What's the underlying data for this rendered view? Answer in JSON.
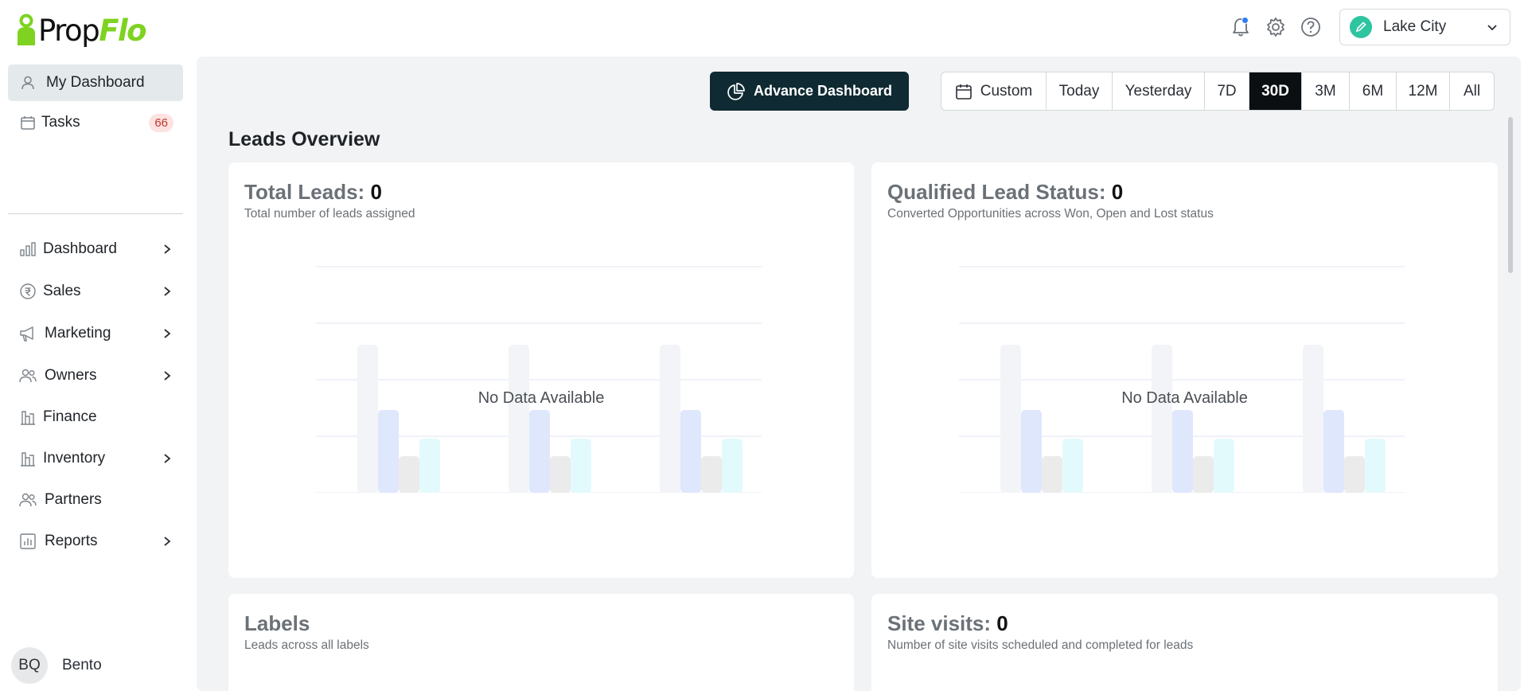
{
  "brand": {
    "prefix": "Prop",
    "suffix": "Flo",
    "accent": "#7ed321"
  },
  "header": {
    "icons": [
      "bell-icon",
      "gear-icon",
      "help-icon"
    ],
    "city": {
      "label": "Lake City"
    }
  },
  "sidebar": {
    "items": [
      {
        "label": "My Dashboard",
        "icon": "user-icon",
        "active": true
      },
      {
        "label": "Tasks",
        "icon": "calendar-icon",
        "badge": "66"
      },
      {
        "label": "Dashboard",
        "icon": "bar-chart-icon",
        "chevron": true
      },
      {
        "label": "Sales",
        "icon": "rupee-icon",
        "chevron": true
      },
      {
        "label": "Marketing",
        "icon": "megaphone-icon",
        "chevron": true
      },
      {
        "label": "Owners",
        "icon": "users-icon",
        "chevron": true
      },
      {
        "label": "Finance",
        "icon": "building-icon"
      },
      {
        "label": "Inventory",
        "icon": "building-icon",
        "chevron": true
      },
      {
        "label": "Partners",
        "icon": "users-icon"
      },
      {
        "label": "Reports",
        "icon": "report-icon",
        "chevron": true
      }
    ],
    "user": {
      "initials": "BQ",
      "name": "Bento"
    }
  },
  "toolbar": {
    "advance_label": "Advance Dashboard",
    "ranges": [
      "Custom",
      "Today",
      "Yesterday",
      "7D",
      "30D",
      "3M",
      "6M",
      "12M",
      "All"
    ],
    "active_range": "30D"
  },
  "main": {
    "section_title": "Leads Overview",
    "cards": [
      {
        "title": "Total Leads:",
        "value": "0",
        "subtitle": "Total number of leads assigned",
        "empty": "No Data Available"
      },
      {
        "title": "Qualified Lead Status:",
        "value": "0",
        "subtitle": "Converted Opportunities across Won, Open and Lost status",
        "empty": "No Data Available"
      },
      {
        "title": "Labels",
        "value": "",
        "subtitle": "Leads across all labels"
      },
      {
        "title": "Site visits:",
        "value": "0",
        "subtitle": "Number of site visits scheduled and completed for leads"
      }
    ]
  }
}
